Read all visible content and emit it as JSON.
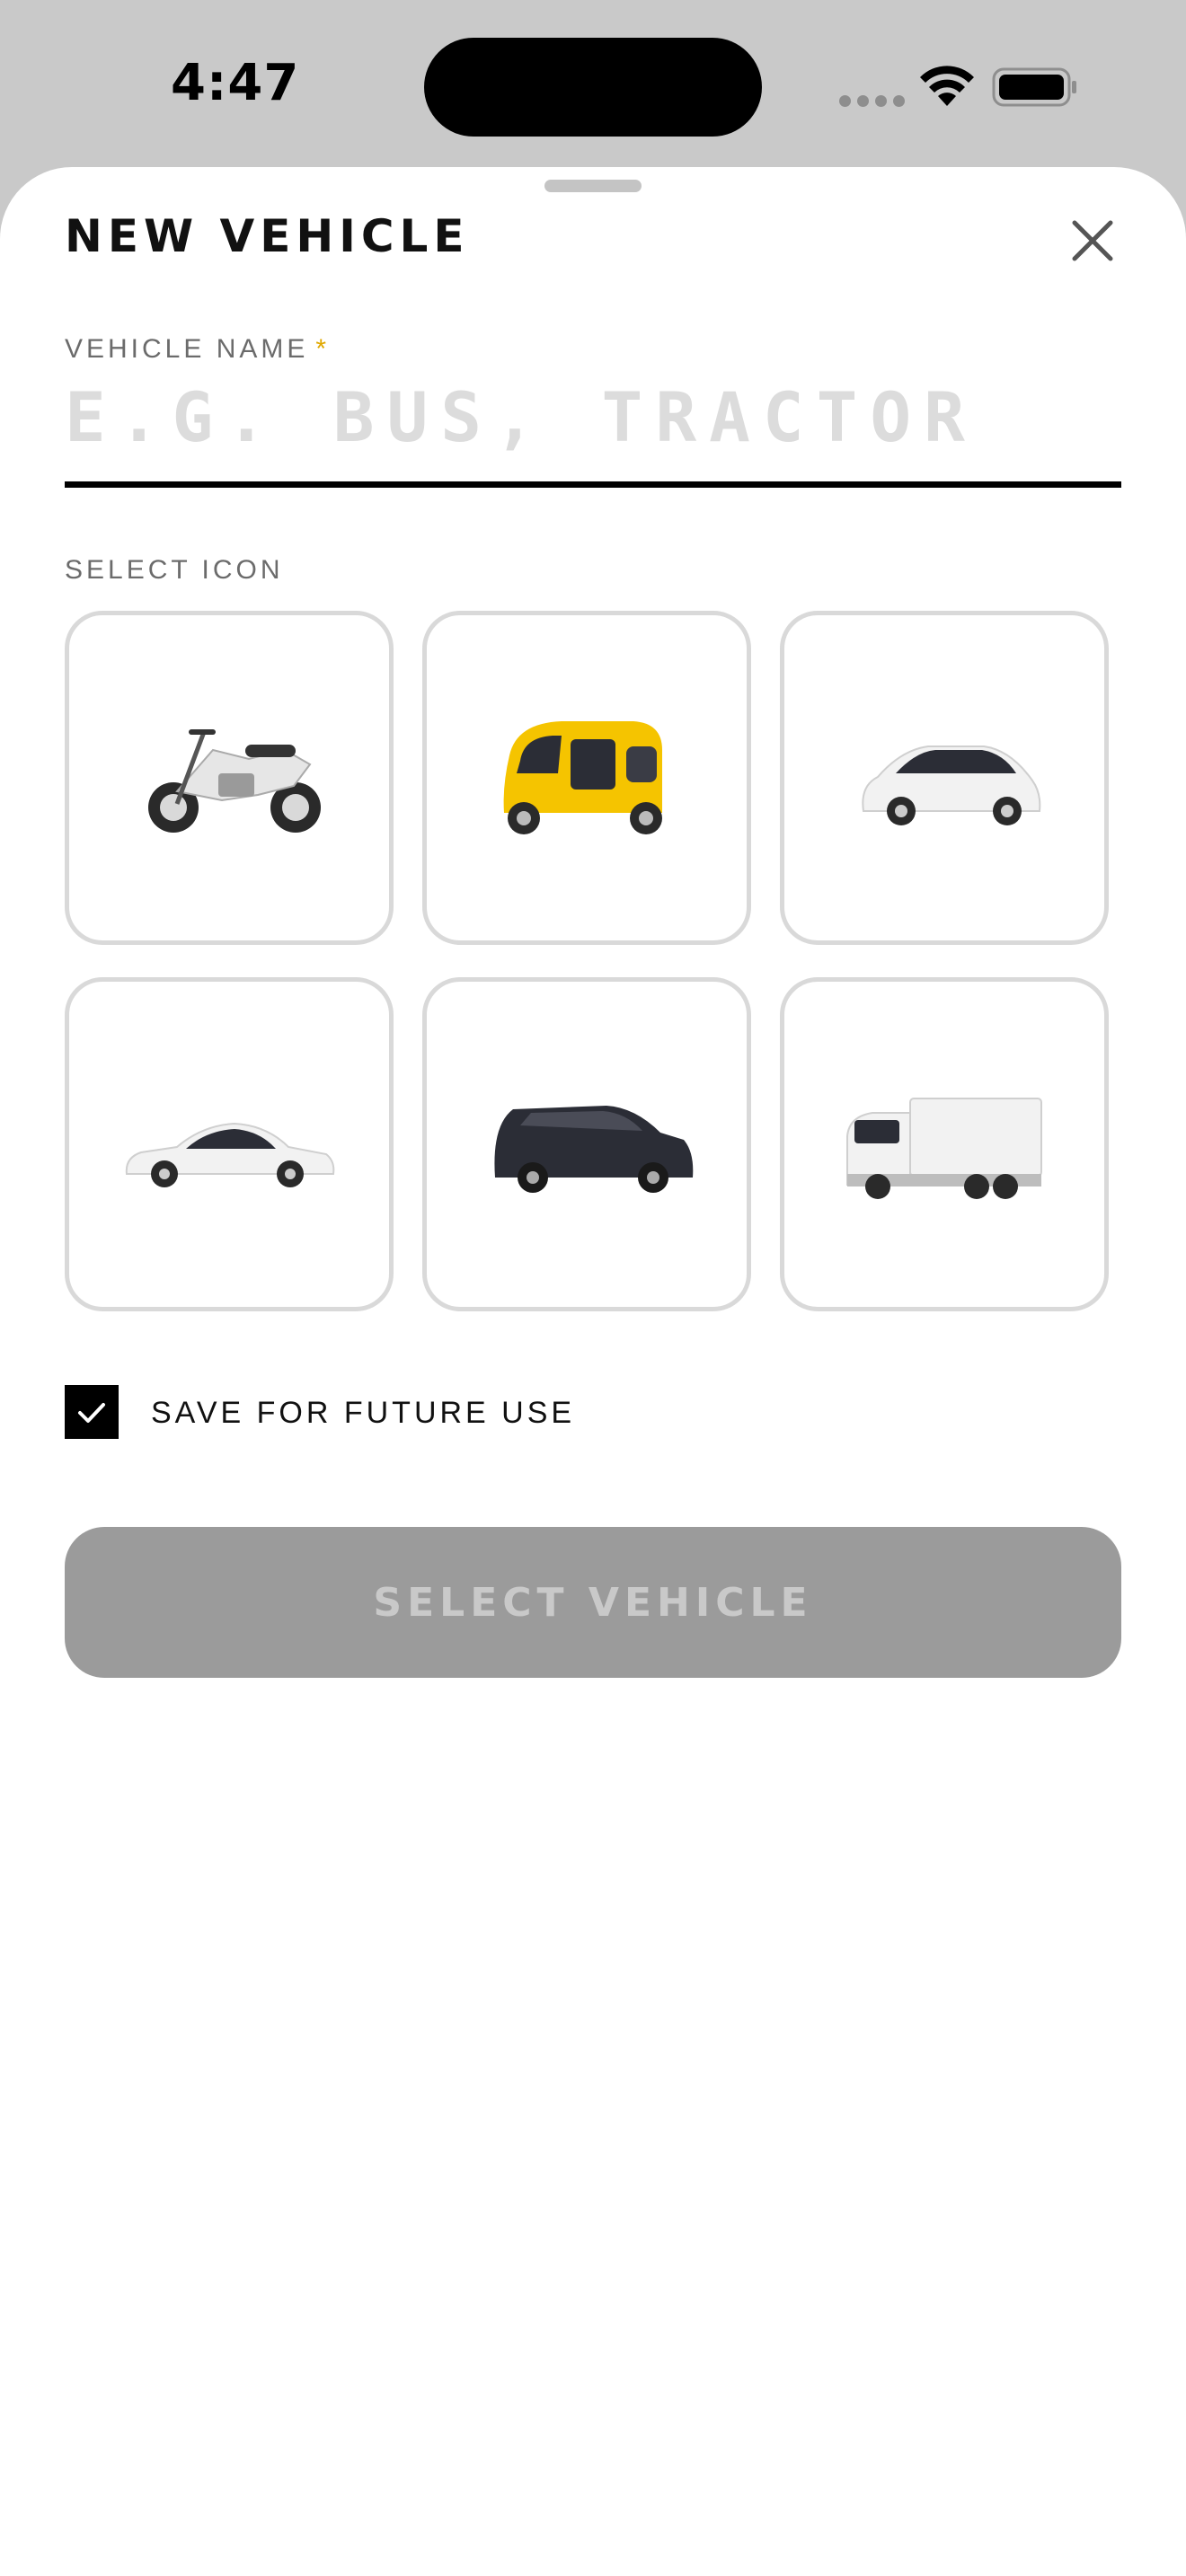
{
  "status_bar": {
    "time": "4:47",
    "icons": [
      "signal-icon",
      "wifi-icon",
      "battery-icon"
    ]
  },
  "sheet": {
    "title": "NEW VEHICLE",
    "close_icon": "close-icon"
  },
  "vehicle_name": {
    "label": "VEHICLE NAME",
    "required_marker": "*",
    "placeholder": "E.G. BUS, TRACTOR",
    "value": ""
  },
  "icon_section": {
    "label": "SELECT ICON",
    "icons": [
      {
        "name": "motorcycle-icon",
        "color": "#e6e6e6"
      },
      {
        "name": "auto-rickshaw-icon",
        "color": "#f5c400"
      },
      {
        "name": "hatchback-car-icon",
        "color": "#f2f2f2"
      },
      {
        "name": "sedan-car-icon",
        "color": "#f2f2f2"
      },
      {
        "name": "suv-car-icon",
        "color": "#2b2d36"
      },
      {
        "name": "truck-icon",
        "color": "#f2f2f2"
      }
    ]
  },
  "save_option": {
    "label": "SAVE FOR FUTURE USE",
    "checked": true
  },
  "primary_button": {
    "label": "SELECT VEHICLE",
    "enabled": false
  },
  "colors": {
    "accent_required": "#e0a800",
    "button_disabled_bg": "#9b9b9b",
    "button_disabled_text": "#c9c9c9"
  }
}
